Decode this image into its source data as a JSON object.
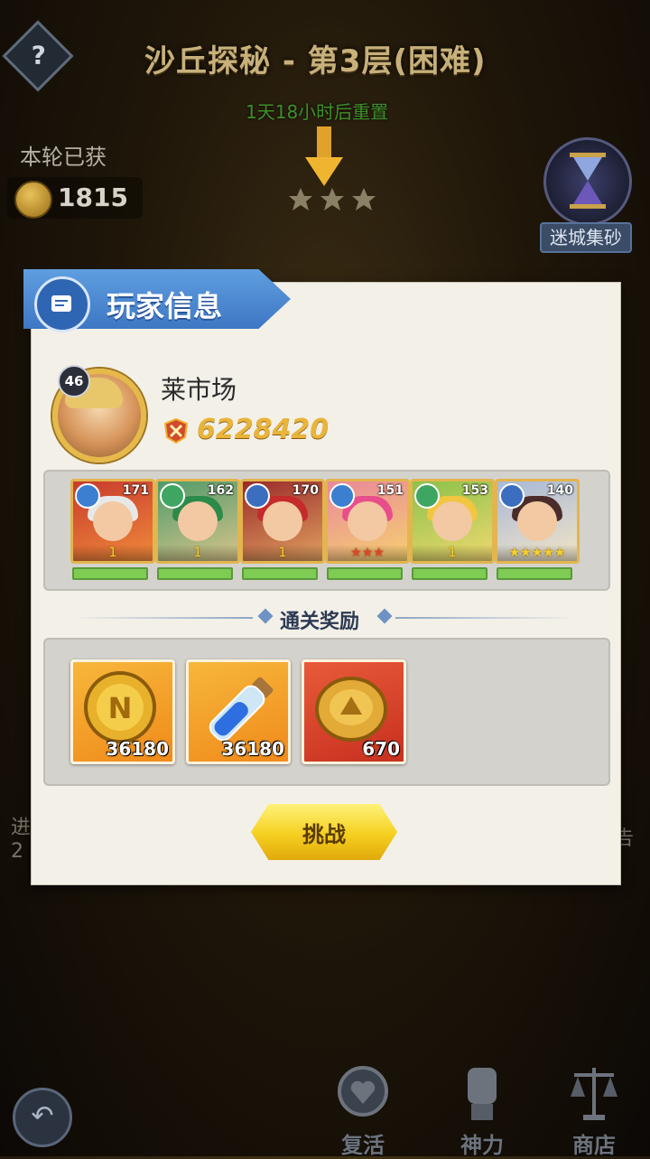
{
  "hud": {
    "help_label": "?",
    "stage_title": "沙丘探秘 - 第3层(困难)",
    "reset_timer": "1天18小时后重置",
    "earned_label": "本轮已获",
    "earned_coins": "1815",
    "side_button_label": "迷城集砂",
    "side_left_text": "进\n2",
    "side_right_text": "告"
  },
  "dialog": {
    "title": "玩家信息",
    "player": {
      "name": "莱市场",
      "level": "46",
      "power": "6228420"
    },
    "team": [
      {
        "level": "171",
        "element": "shield",
        "stars": "1"
      },
      {
        "level": "162",
        "element": "nature",
        "stars": "1"
      },
      {
        "level": "170",
        "element": "moon",
        "stars": "1"
      },
      {
        "level": "151",
        "element": "shield",
        "stars": "3"
      },
      {
        "level": "153",
        "element": "nature",
        "stars": "1"
      },
      {
        "level": "140",
        "element": "moon",
        "stars": "5"
      }
    ],
    "rewards_title": "通关奖励",
    "rewards": [
      {
        "item": "gold-coin",
        "quantity": "36180"
      },
      {
        "item": "exp-potion",
        "quantity": "36180"
      },
      {
        "item": "arena-coin",
        "quantity": "670"
      }
    ],
    "challenge_label": "挑战"
  },
  "nav": {
    "back_label": "↶",
    "items": [
      {
        "label": "复活"
      },
      {
        "label": "神力"
      },
      {
        "label": "商店"
      }
    ]
  },
  "colors": {
    "panel_bg": "#f3f0e8",
    "header_blue": "#4a87d0",
    "power_gold": "#e9b43a",
    "button_yellow": "#f5cf1f",
    "hp_green": "#7fcc55"
  }
}
